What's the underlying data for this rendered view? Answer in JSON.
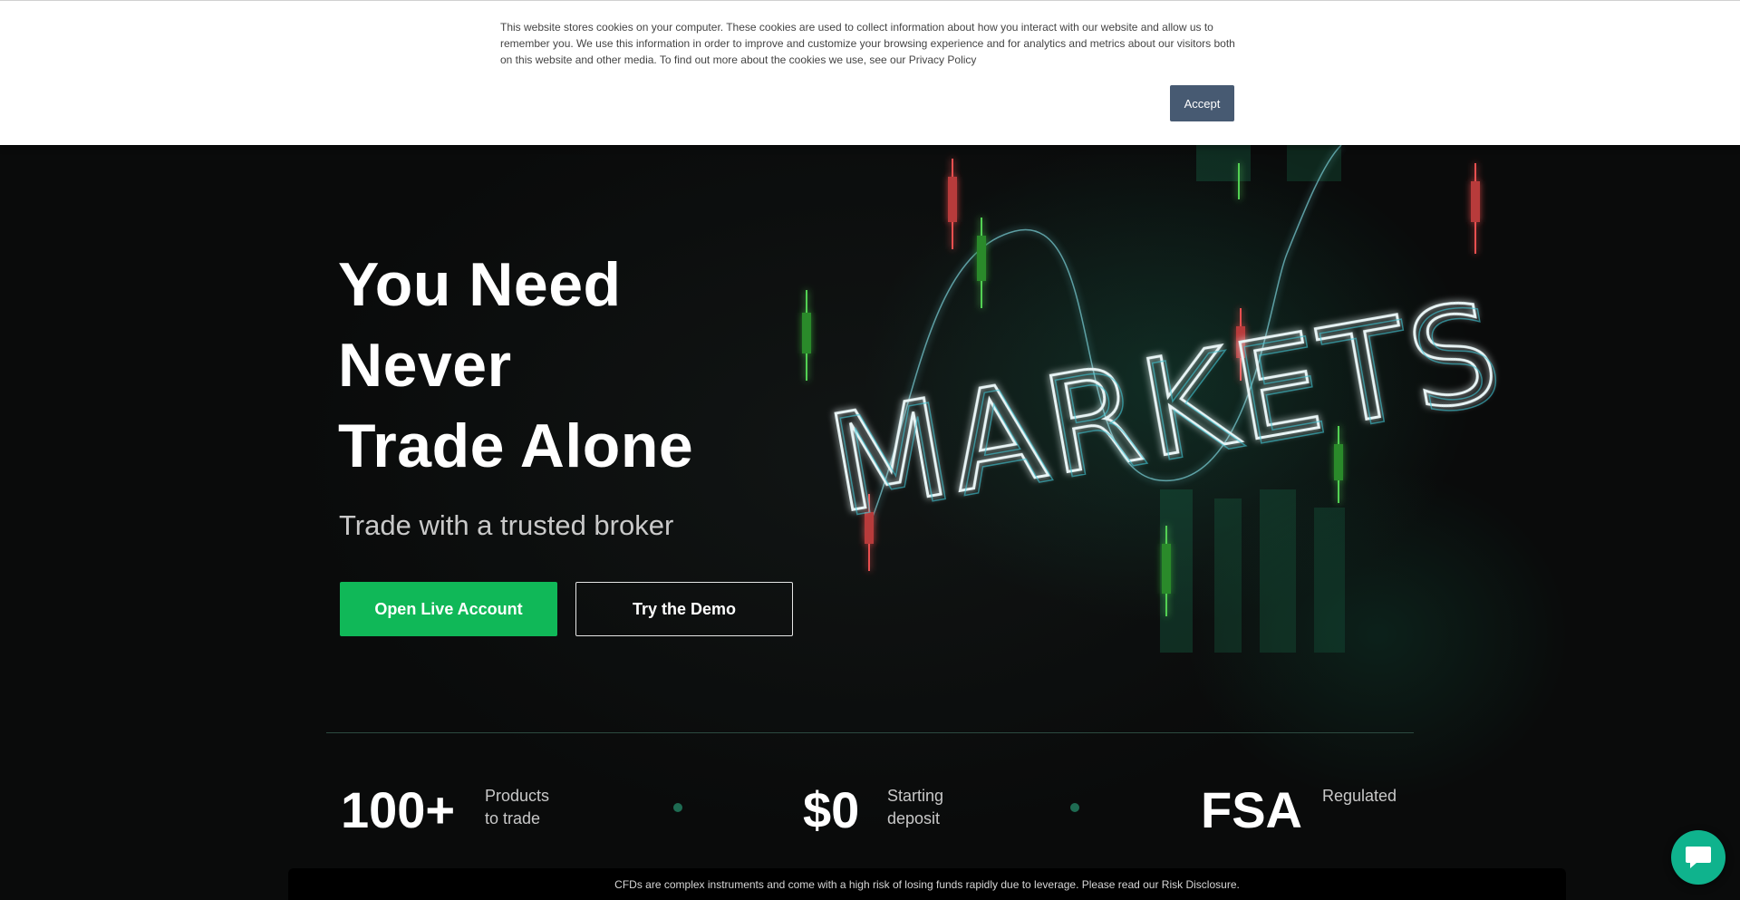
{
  "cookie_banner": {
    "text": "This website stores cookies on your computer. These cookies are used to collect information about how you interact with our website and allow us to remember you. We use this information in order to improve and customize your browsing experience and for analytics and metrics about our visitors both on this website and other media. To find out more about the cookies we use, see our Privacy Policy",
    "accept_label": "Accept"
  },
  "hero": {
    "title_lines": [
      "You Need",
      "Never",
      "Trade Alone"
    ],
    "subtitle": "Trade with a trusted broker",
    "primary_button": "Open Live Account",
    "secondary_button": "Try the Demo",
    "art_text": "MARKETS"
  },
  "stats": [
    {
      "value": "100+",
      "label_lines": [
        "Products",
        "to trade"
      ]
    },
    {
      "value": "$0",
      "label_lines": [
        "Starting",
        "deposit"
      ]
    },
    {
      "value": "FSA",
      "label_lines": [
        "Regulated"
      ]
    }
  ],
  "risk_disclosure": "CFDs are complex instruments and come with a high risk of losing funds rapidly due to leverage. Please read our Risk Disclosure.",
  "chat": {
    "icon": "chat-bubble-icon"
  },
  "colors": {
    "primary_green": "#10b858",
    "accept_button": "#475a72",
    "chat_button": "#0fb38d",
    "background": "#0a0b0b"
  }
}
